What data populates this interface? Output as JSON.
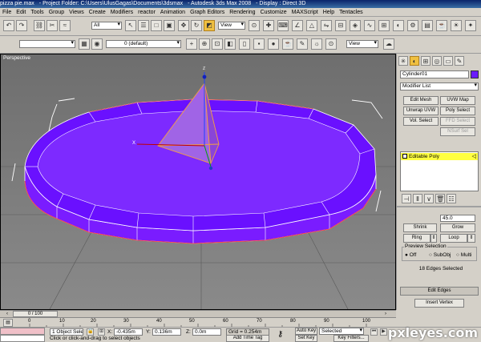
{
  "window": {
    "title_parts": [
      "pizza pie.max",
      "- Project Folder: C:\\Users\\UlusGagas\\Documents\\3dsmax",
      "- Autodesk 3ds Max 2008",
      "- Display : Direct 3D"
    ]
  },
  "menu": [
    "File",
    "Edit",
    "Tools",
    "Group",
    "Views",
    "Create",
    "Modifiers",
    "reactor",
    "Animation",
    "Graph Editors",
    "Rendering",
    "Customize",
    "MAXScript",
    "Help",
    "Tentacles"
  ],
  "toolbar": {
    "selection_filter": "All",
    "view_dropdown": "View",
    "layer_dropdown": "0 (default)",
    "view_dropdown_2": "View"
  },
  "viewport": {
    "label": "Perspective",
    "axis_x": "X",
    "axis_z": "Z"
  },
  "command_panel": {
    "object_name": "Cylinder01",
    "object_color": "#6a1aff",
    "modifier_list": "Modifier List",
    "buttons": [
      "Edit Mesh",
      "UVW Map",
      "Unwrap UVW",
      "Poly Select",
      "Vol. Select",
      "FFD Select",
      "NSurf Sel"
    ],
    "stack_item": "Editable Poly",
    "spinner_partial": "45.0",
    "shrink": "Shrink",
    "grow": "Grow",
    "ring": "Ring",
    "loop": "Loop",
    "preview_title": "Preview Selection",
    "preview_options": [
      "Off",
      "SubObj",
      "Multi"
    ],
    "selected_status": "18 Edges Selected",
    "edit_edges": "Edit Edges",
    "insert_vertex": "Insert Vertex"
  },
  "timeline": {
    "frame": "0 / 100",
    "ticks": [
      "0",
      "10",
      "20",
      "30",
      "40",
      "50",
      "60",
      "70",
      "80",
      "90",
      "100"
    ]
  },
  "status": {
    "selected": "1 Object Sele",
    "x": "-0.435m",
    "y": "0.136m",
    "z": "0.0m",
    "x_label": "X:",
    "y_label": "Y:",
    "z_label": "Z:",
    "grid": "Grid = 0.254m",
    "prompt": "Click or click-and-drag to select objects",
    "add_time_tag": "Add Time Tag",
    "auto_key": "Auto Key",
    "set_key": "Set Key",
    "key_mode": "Selected",
    "key_filters": "Key Filters..."
  },
  "watermark": "pxleyes.com"
}
